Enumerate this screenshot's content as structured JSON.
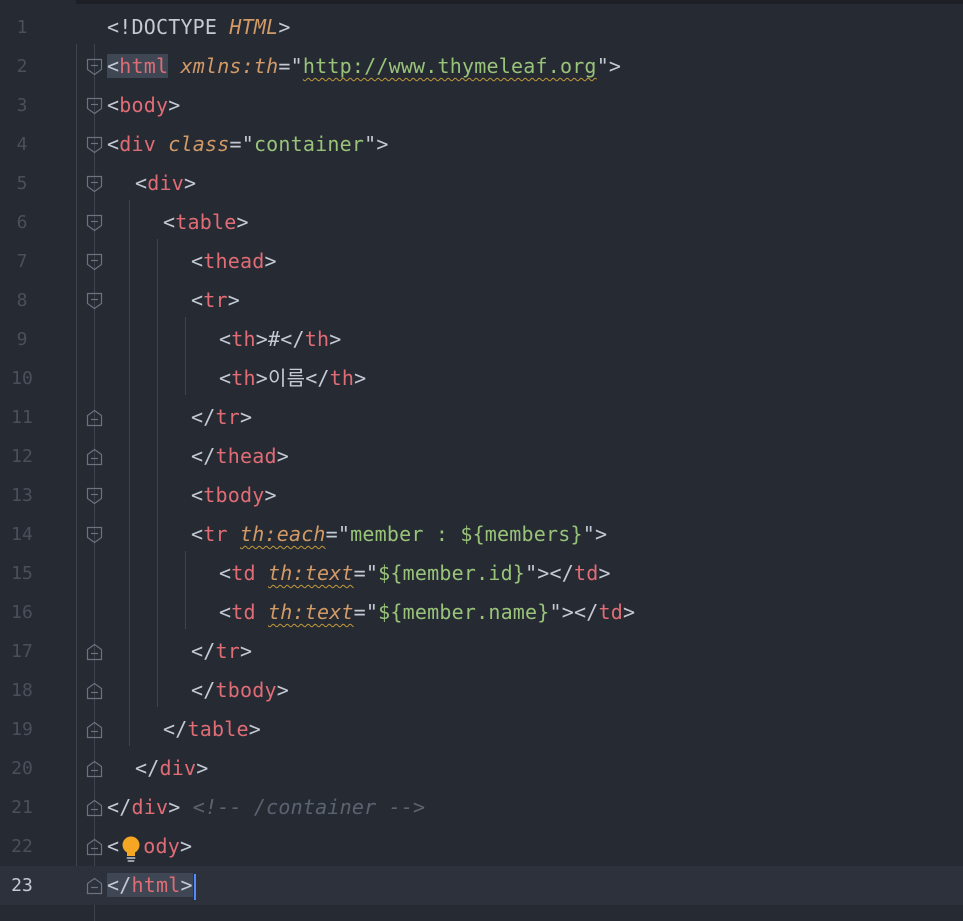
{
  "editor": {
    "current_line": 23,
    "lines": [
      {
        "n": "1"
      },
      {
        "n": "2"
      },
      {
        "n": "3"
      },
      {
        "n": "4"
      },
      {
        "n": "5"
      },
      {
        "n": "6"
      },
      {
        "n": "7"
      },
      {
        "n": "8"
      },
      {
        "n": "9"
      },
      {
        "n": "10"
      },
      {
        "n": "11"
      },
      {
        "n": "12"
      },
      {
        "n": "13"
      },
      {
        "n": "14"
      },
      {
        "n": "15"
      },
      {
        "n": "16"
      },
      {
        "n": "17"
      },
      {
        "n": "18"
      },
      {
        "n": "19"
      },
      {
        "n": "20"
      },
      {
        "n": "21"
      },
      {
        "n": "22"
      },
      {
        "n": "23"
      }
    ],
    "code": {
      "l1_open": "<!DOCTYPE ",
      "l1_kw": "HTML",
      "l1_close": ">",
      "tag_html": "html",
      "attr_xmlns": "xmlns:th",
      "xmlns_url": "http://www.thymeleaf.org",
      "tag_body": "body",
      "tag_div": "div",
      "attr_class": "class",
      "class_val": "container",
      "tag_table": "table",
      "tag_thead": "thead",
      "tag_tr": "tr",
      "tag_th": "th",
      "th1_text": "#",
      "th2_text": "이름",
      "tag_tbody": "tbody",
      "attr_each": "th:each",
      "each_val": "member : ${members}",
      "tag_td": "td",
      "attr_text": "th:text",
      "td1_val": "${member.id}",
      "td2_val": "${member.name}",
      "comment": "<!-- /container -->",
      "l22_tail": "ody"
    },
    "icons": {
      "fold_open": "fold-open-icon",
      "fold_close": "fold-close-icon",
      "bulb": "lightbulb-icon"
    },
    "colors": {
      "background": "#262a33",
      "tag": "#e06c75",
      "attribute": "#d19a66",
      "string": "#98c379",
      "comment": "#5c6370",
      "caret": "#528bff",
      "bulb": "#f5a623"
    }
  }
}
